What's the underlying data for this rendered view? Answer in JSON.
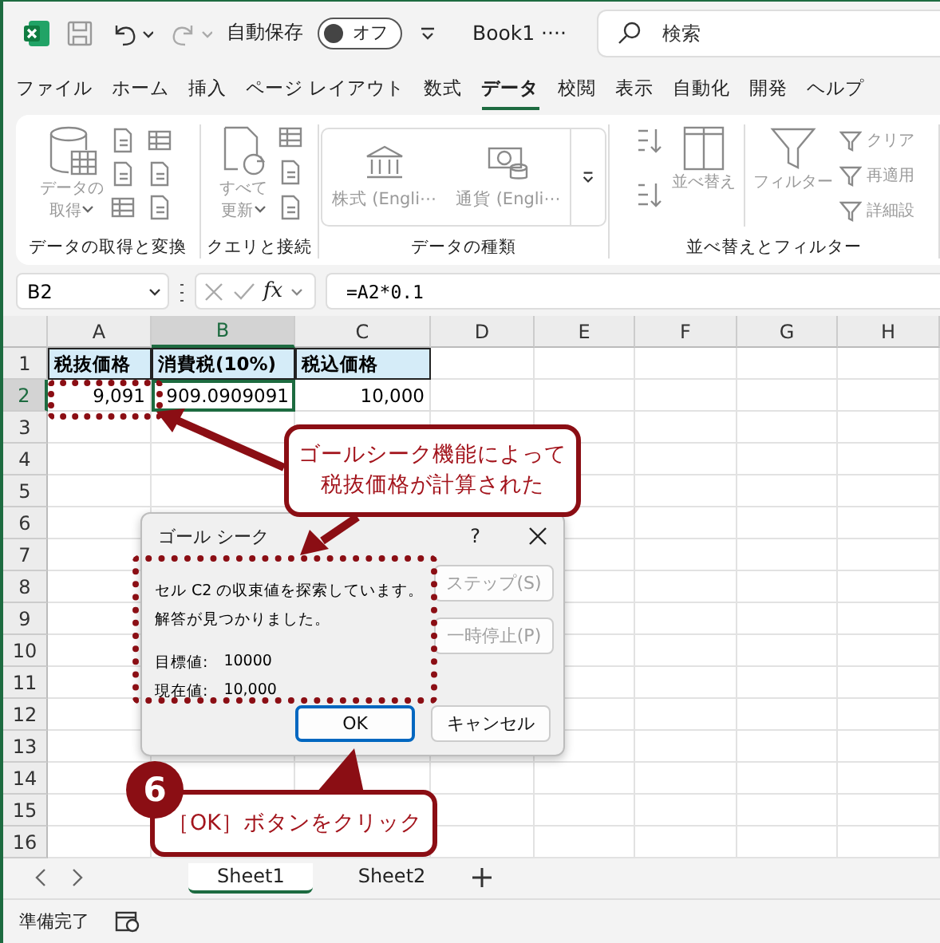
{
  "title_bar": {
    "autosave": {
      "label": "自動保存",
      "toggle_label": "オフ",
      "on": false
    },
    "document": "Book1 ····",
    "search": {
      "placeholder": "検索"
    }
  },
  "tabs": [
    {
      "label": "ファイル",
      "selected": false
    },
    {
      "label": "ホーム",
      "selected": false
    },
    {
      "label": "挿入",
      "selected": false
    },
    {
      "label": "ページ レイアウト",
      "selected": false
    },
    {
      "label": "数式",
      "selected": false
    },
    {
      "label": "データ",
      "selected": true
    },
    {
      "label": "校閲",
      "selected": false
    },
    {
      "label": "表示",
      "selected": false
    },
    {
      "label": "自動化",
      "selected": false
    },
    {
      "label": "開発",
      "selected": false
    },
    {
      "label": "ヘルプ",
      "selected": false
    }
  ],
  "ribbon": {
    "groups": [
      {
        "kind": "get_data",
        "label": "データの取得と変換",
        "commands": [
          {
            "lines": [
              "データの",
              "取得"
            ],
            "disabled": true
          }
        ]
      },
      {
        "kind": "queries",
        "label": "クエリと接続",
        "commands": [
          {
            "lines": [
              "すべて",
              "更新"
            ],
            "disabled": true
          }
        ]
      },
      {
        "kind": "data_types",
        "label": "データの種類",
        "commands": [
          {
            "lines": [
              "株式 (Engli⋯"
            ],
            "disabled": true
          },
          {
            "lines": [
              "通貨 (Engli⋯"
            ],
            "disabled": true
          }
        ]
      },
      {
        "kind": "sort_filter",
        "label": "並べ替えとフィルター",
        "commands": [
          {
            "lines": [
              "並べ替え"
            ],
            "disabled": true
          },
          {
            "lines": [
              "フィルター"
            ],
            "disabled": true
          },
          {
            "lines": [
              "クリア"
            ],
            "disabled": true
          },
          {
            "lines": [
              "再適用"
            ],
            "disabled": true
          },
          {
            "lines": [
              "詳細設"
            ],
            "disabled": true
          }
        ]
      }
    ]
  },
  "formula_bar": {
    "name_box": "B2",
    "function_label": "fx",
    "formula": "=A2*0.1"
  },
  "sheet": {
    "columns": [
      {
        "label": "A",
        "selected": false
      },
      {
        "label": "B",
        "selected": true
      },
      {
        "label": "C",
        "selected": false
      },
      {
        "label": "D",
        "selected": false
      },
      {
        "label": "E",
        "selected": false
      },
      {
        "label": "F",
        "selected": false
      },
      {
        "label": "G",
        "selected": false
      },
      {
        "label": "H",
        "selected": false
      }
    ],
    "rows": [
      {
        "number": "1",
        "selected": false,
        "cells": [
          {
            "text": "税抜価格",
            "kind": "header",
            "selected": false
          },
          {
            "text": "消費税(10%)",
            "kind": "header",
            "selected": false
          },
          {
            "text": "税込価格",
            "kind": "header",
            "selected": false
          }
        ]
      },
      {
        "number": "2",
        "selected": true,
        "cells": [
          {
            "text": "9,091",
            "kind": "value",
            "selected": false
          },
          {
            "text": "909.0909091",
            "kind": "value",
            "selected": true
          },
          {
            "text": "10,000",
            "kind": "value",
            "selected": false
          }
        ]
      },
      {
        "number": "3",
        "selected": false
      },
      {
        "number": "4",
        "selected": false
      },
      {
        "number": "5",
        "selected": false
      },
      {
        "number": "6",
        "selected": false
      },
      {
        "number": "7",
        "selected": false
      },
      {
        "number": "8",
        "selected": false
      },
      {
        "number": "9",
        "selected": false
      },
      {
        "number": "10",
        "selected": false
      },
      {
        "number": "11",
        "selected": false
      },
      {
        "number": "12",
        "selected": false
      },
      {
        "number": "13",
        "selected": false
      },
      {
        "number": "14",
        "selected": false
      },
      {
        "number": "15",
        "selected": false
      },
      {
        "number": "16",
        "selected": false
      }
    ]
  },
  "dialog": {
    "title": "ゴール シーク",
    "help": "?",
    "messages": [
      "セル C2 の収束値を探索しています。",
      "解答が見つかりました。"
    ],
    "fields": [
      {
        "label": "目標値:",
        "value": "10000"
      },
      {
        "label": "現在値:",
        "value": "10,000"
      }
    ],
    "side_buttons": [
      {
        "label": "ステップ(S)",
        "disabled": true
      },
      {
        "label": "一時停止(P)",
        "disabled": true
      }
    ],
    "footer_buttons": [
      {
        "label": "OK",
        "default": true
      },
      {
        "label": "キャンセル",
        "default": false
      }
    ]
  },
  "callouts": [
    {
      "lines": [
        "ゴールシーク機能によって",
        "税抜価格が計算された"
      ]
    }
  ],
  "step": {
    "number": "6",
    "text": "［OK］ボタンをクリック"
  },
  "sheet_tabs": [
    {
      "label": "Sheet1",
      "selected": true
    },
    {
      "label": "Sheet2",
      "selected": false
    }
  ],
  "status_bar": {
    "text": "準備完了"
  }
}
